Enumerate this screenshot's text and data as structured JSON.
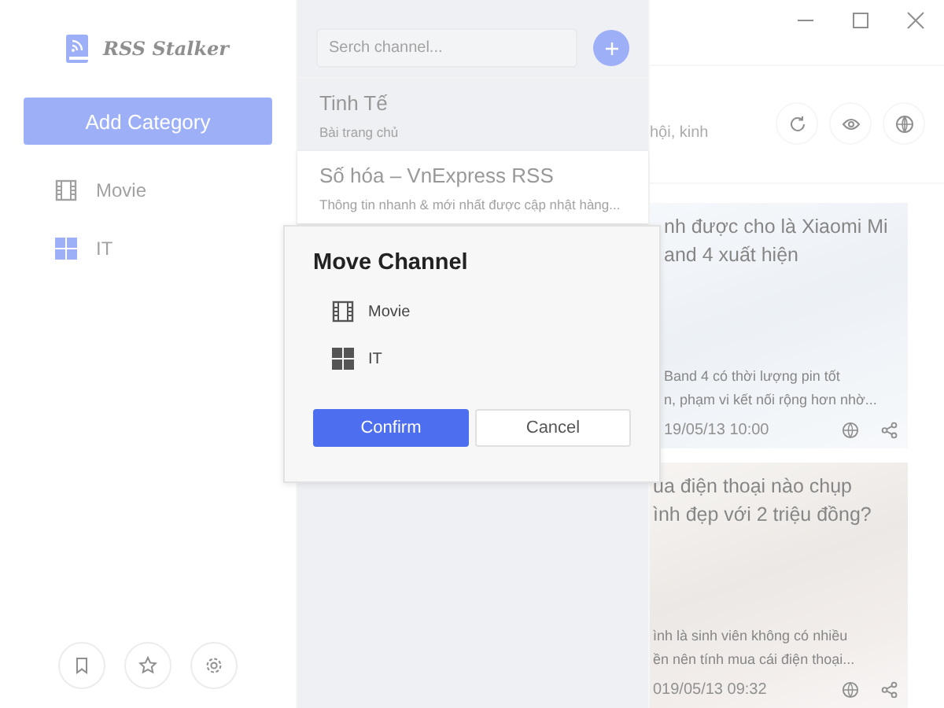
{
  "app": {
    "name": "RSS Stalker"
  },
  "sidebar": {
    "add_button": "Add Category",
    "categories": [
      {
        "name": "Movie",
        "kind": "film",
        "selected": false
      },
      {
        "name": "IT",
        "kind": "grid",
        "selected": true
      }
    ]
  },
  "channel_list": {
    "search": {
      "placeholder": "Serch channel..."
    },
    "channels": [
      {
        "name": "Tinh Tế",
        "description": "Bài trang chủ",
        "selected": false
      },
      {
        "name": "Số hóa – VnExpress RSS",
        "description": "Thông tin nhanh & mới nhất được cập nhật hàng...",
        "selected": true
      }
    ]
  },
  "content": {
    "description": "hội, kinh",
    "articles": [
      {
        "title": [
          "nh được cho là Xiaomi Mi",
          "and 4 xuất hiện"
        ],
        "summary": [
          "Band 4 có thời lượng pin tốt",
          "n, phạm vi kết nối rộng hơn nhờ..."
        ],
        "date": "19/05/13 10:00"
      },
      {
        "title": [
          "ua điện thoại nào chụp",
          "ình đẹp với 2 triệu đồng?"
        ],
        "summary": [
          "ình là sinh viên không có nhiều",
          "ền nên tính mua cái điện thoại..."
        ],
        "date": "019/05/13 09:32"
      }
    ]
  },
  "dialog": {
    "title": "Move Channel",
    "options": [
      {
        "name": "Movie",
        "kind": "film"
      },
      {
        "name": "IT",
        "kind": "grid"
      }
    ],
    "buttons": [
      {
        "label": "Confirm",
        "kind": "primary"
      },
      {
        "label": "Cancel",
        "kind": "secondary"
      }
    ]
  }
}
